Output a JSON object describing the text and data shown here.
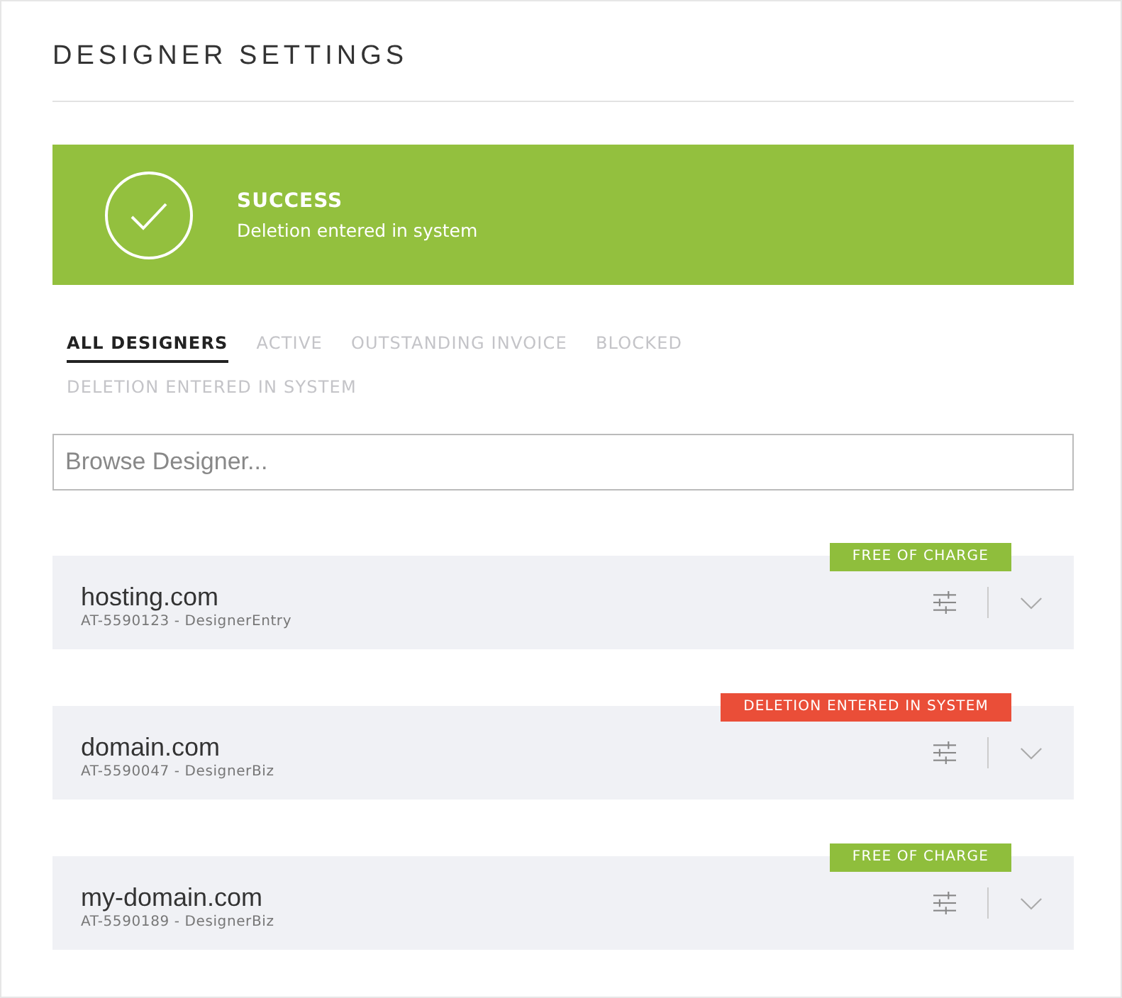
{
  "page": {
    "title": "DESIGNER SETTINGS"
  },
  "alert": {
    "kind": "success",
    "title": "SUCCESS",
    "message": "Deletion entered in system"
  },
  "tabs": [
    {
      "label": "ALL DESIGNERS",
      "selected": true
    },
    {
      "label": "ACTIVE",
      "selected": false
    },
    {
      "label": "OUTSTANDING INVOICE",
      "selected": false
    },
    {
      "label": "BLOCKED",
      "selected": false
    },
    {
      "label": "DELETION ENTERED IN SYSTEM",
      "selected": false
    }
  ],
  "search": {
    "placeholder": "Browse Designer..."
  },
  "designers": [
    {
      "name": "hosting.com",
      "details": "AT-5590123 - DesignerEntry",
      "badge": "FREE OF CHARGE",
      "color": "#8fbe3c"
    },
    {
      "name": "domain.com",
      "details": "AT-5590047 - DesignerBiz",
      "badge": "DELETION ENTERED IN SYSTEM",
      "color": "#ea4e38"
    },
    {
      "name": "my-domain.com",
      "details": "AT-5590189 - DesignerBiz",
      "badge": "FREE OF CHARGE",
      "color": "#8fbe3c"
    }
  ]
}
